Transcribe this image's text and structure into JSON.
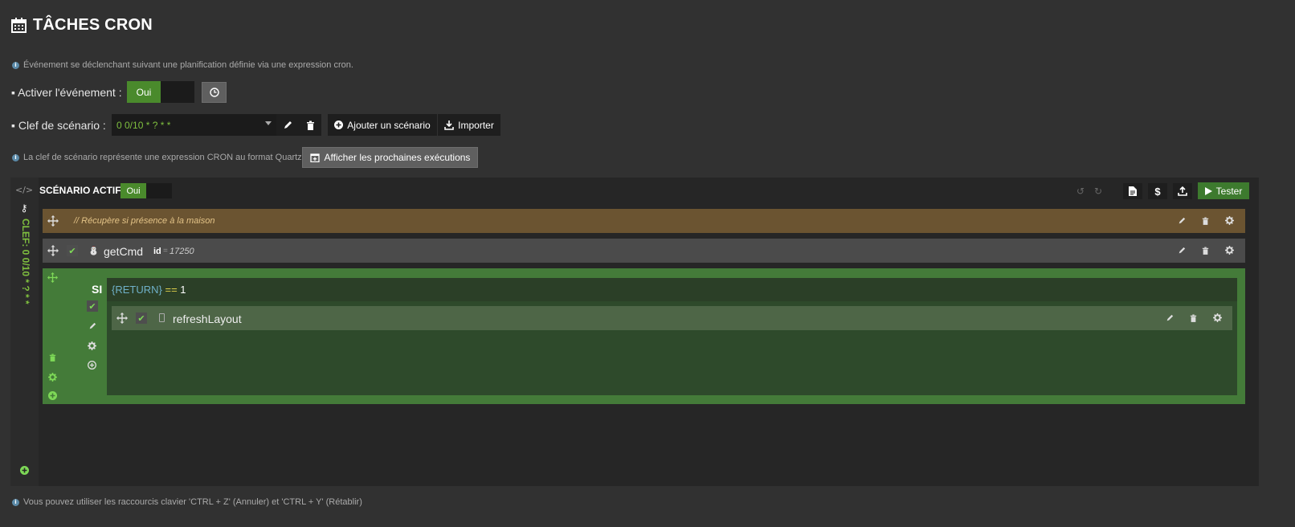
{
  "header": {
    "title": "TÂCHES CRON"
  },
  "info": {
    "description": "Événement se déclenchant suivant une planification définie via une expression cron.",
    "key_help": "La clef de scénario représente une expression CRON au format Quartz.",
    "shortcuts": "Vous pouvez utiliser les raccourcis clavier 'CTRL + Z' (Annuler) et 'CTRL + Y' (Rétablir)"
  },
  "activate": {
    "label": "▪ Activer l'événement :",
    "value": "Oui"
  },
  "scenario_key": {
    "label": "▪ Clef de scénario :",
    "value": "0 0/10 * ? * *",
    "add_label": "Ajouter un scénario",
    "import_label": "Importer"
  },
  "next_runs_label": "Afficher les prochaines exécutions",
  "editor": {
    "active_label": "SCÉNARIO ACTIF:",
    "active_value": "Oui",
    "test_label": "Tester",
    "vertical_key": "CLEF: 0 0/10 * ? * *",
    "comment": "// Récupère si présence à la maison",
    "getcmd": {
      "name": "getCmd",
      "id_label": "id",
      "id_sep": "=",
      "id_value": "17250"
    },
    "si": {
      "label": "SI",
      "return": "{RETURN}",
      "op": "==",
      "value": "1"
    },
    "refresh": {
      "name": "refreshLayout"
    }
  },
  "colors": {
    "accent_green": "#4a8a2c",
    "comment_bg": "#6b5431",
    "block_green": "#447b39",
    "inner_green": "#2e4a2b",
    "link_green": "#7fbf3f"
  }
}
